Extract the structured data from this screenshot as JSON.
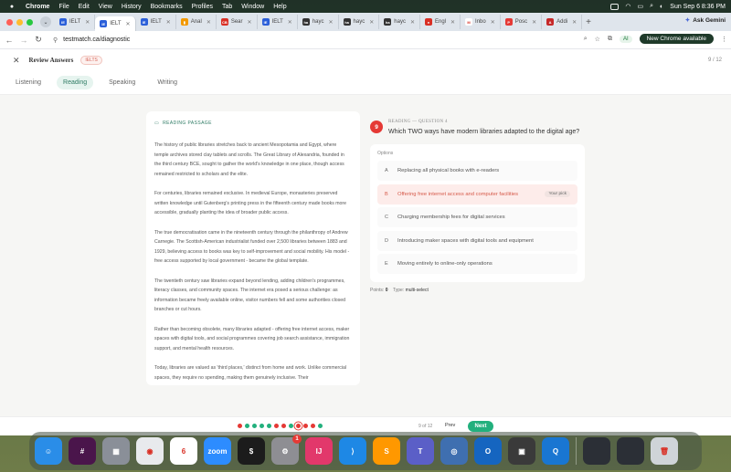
{
  "menubar": {
    "app": "Chrome",
    "menus": [
      "File",
      "Edit",
      "View",
      "History",
      "Bookmarks",
      "Profiles",
      "Tab",
      "Window",
      "Help"
    ],
    "datetime": "Sun Sep 6  8:36 PM"
  },
  "browser": {
    "tabs": [
      {
        "label": "IELT",
        "color": "#2b5fd9",
        "icon": "IE"
      },
      {
        "label": "IELT",
        "color": "#2b5fd9",
        "icon": "IE",
        "active": true
      },
      {
        "label": "IELT",
        "color": "#2b5fd9",
        "icon": "IE"
      },
      {
        "label": "Anal",
        "color": "#f29900",
        "icon": "▮"
      },
      {
        "label": "Sear",
        "color": "#d93025",
        "icon": "CB"
      },
      {
        "label": "IELT",
        "color": "#2b5fd9",
        "icon": "IE"
      },
      {
        "label": "hayc",
        "color": "#333333",
        "icon": "ha"
      },
      {
        "label": "hayc",
        "color": "#333333",
        "icon": "ha"
      },
      {
        "label": "hayc",
        "color": "#333333",
        "icon": "ha"
      },
      {
        "label": "Engl",
        "color": "#d93025",
        "icon": "●"
      },
      {
        "label": "Inbo",
        "color": "#ffffff",
        "icon": "M"
      },
      {
        "label": "Posc",
        "color": "#e53935",
        "icon": "P"
      },
      {
        "label": "Addi",
        "color": "#c62828",
        "icon": "A"
      }
    ],
    "ask_gemini": "Ask Gemini",
    "url": "testmatch.ca/diagnostic",
    "ai_badge": "AI",
    "new_chrome": "New Chrome available"
  },
  "page": {
    "title": "Review Answers",
    "badge": "IELTS",
    "progress": "9 / 12",
    "skill_tabs": [
      "Listening",
      "Reading",
      "Speaking",
      "Writing"
    ],
    "active_tab": "Reading"
  },
  "passage": {
    "label": "READING PASSAGE",
    "paragraphs": [
      "The history of public libraries stretches back to ancient Mesopotamia and Egypt, where temple archives stored clay tablets and scrolls. The Great Library of Alexandria, founded in the third century BCE, sought to gather the world's knowledge in one place, though access remained restricted to scholars and the elite.",
      "For centuries, libraries remained exclusive. In medieval Europe, monasteries preserved written knowledge until Gutenberg's printing press in the fifteenth century made books more accessible, gradually planting the idea of broader public access.",
      "The true democratisation came in the nineteenth century through the philanthropy of Andrew Carnegie. The Scottish-American industrialist funded over 2,500 libraries between 1883 and 1929, believing access to books was key to self-improvement and social mobility. His model - free access supported by local government - became the global template.",
      "The twentieth century saw libraries expand beyond lending, adding children's programmes, literacy classes, and community spaces. The internet era posed a serious challenge: as information became freely available online, visitor numbers fell and some authorities closed branches or cut hours.",
      "Rather than becoming obsolete, many libraries adapted - offering free internet access, maker spaces with digital tools, and social programmes covering job search assistance, immigration support, and mental health resources.",
      "Today, libraries are valued as 'third places,' distinct from home and work. Unlike commercial spaces, they require no spending, making them genuinely inclusive. Their"
    ]
  },
  "question": {
    "number": "9",
    "meta": "READING — QUESTION 4",
    "text": "Which TWO ways have modern libraries adapted to the digital age?",
    "options_label": "Options",
    "options": [
      {
        "letter": "A",
        "text": "Replacing all physical books with e-readers"
      },
      {
        "letter": "B",
        "text": "Offering free internet access and computer facilities",
        "picked": true,
        "tag": "Your pick"
      },
      {
        "letter": "C",
        "text": "Charging membership fees for digital services"
      },
      {
        "letter": "D",
        "text": "Introducing maker spaces with digital tools and equipment"
      },
      {
        "letter": "E",
        "text": "Moving entirely to online-only operations"
      }
    ],
    "points_label": "Points:",
    "points_value": "0",
    "type_label": "Type:",
    "type_value": "multi-select"
  },
  "footer": {
    "dots": [
      "#e53935",
      "#22b07d",
      "#22b07d",
      "#22b07d",
      "#22b07d",
      "#e53935",
      "#e53935",
      "#22b07d",
      "#e53935",
      "#e53935",
      "#e53935",
      "#22b07d"
    ],
    "page_of": "9 of 12",
    "prev": "Prev",
    "next": "Next"
  },
  "dock": {
    "apps": [
      {
        "name": "finder",
        "color": "#2a8de8",
        "glyph": "☺"
      },
      {
        "name": "slack",
        "color": "#4a154b",
        "glyph": "#"
      },
      {
        "name": "launchpad",
        "color": "#8a8f98",
        "glyph": "▦"
      },
      {
        "name": "chrome",
        "color": "#e8eaed",
        "glyph": "◉"
      },
      {
        "name": "calendar",
        "color": "#ffffff",
        "glyph": "6"
      },
      {
        "name": "zoom",
        "color": "#2d8cff",
        "glyph": "zoom"
      },
      {
        "name": "terminal",
        "color": "#1c1c1c",
        "glyph": "$"
      },
      {
        "name": "system-settings",
        "color": "#8e8e93",
        "glyph": "⚙",
        "badge": "1"
      },
      {
        "name": "intellij",
        "color": "#e2386b",
        "glyph": "IJ"
      },
      {
        "name": "vscode",
        "color": "#1e88e5",
        "glyph": "⟩"
      },
      {
        "name": "sublime",
        "color": "#ff9800",
        "glyph": "S"
      },
      {
        "name": "teams",
        "color": "#5b5fc7",
        "glyph": "T"
      },
      {
        "name": "database",
        "color": "#3f6fb0",
        "glyph": "◎"
      },
      {
        "name": "outlook",
        "color": "#1565c0",
        "glyph": "O"
      },
      {
        "name": "virtualbox",
        "color": "#3a3a3a",
        "glyph": "▣"
      },
      {
        "name": "quicktime",
        "color": "#1976d2",
        "glyph": "Q"
      }
    ],
    "extras": [
      {
        "name": "window-thumb-1",
        "color": "#2b2f36",
        "glyph": ""
      },
      {
        "name": "window-thumb-2",
        "color": "#2b2f36",
        "glyph": ""
      },
      {
        "name": "trash",
        "color": "#cfd4d8",
        "glyph": "🗑"
      }
    ]
  }
}
